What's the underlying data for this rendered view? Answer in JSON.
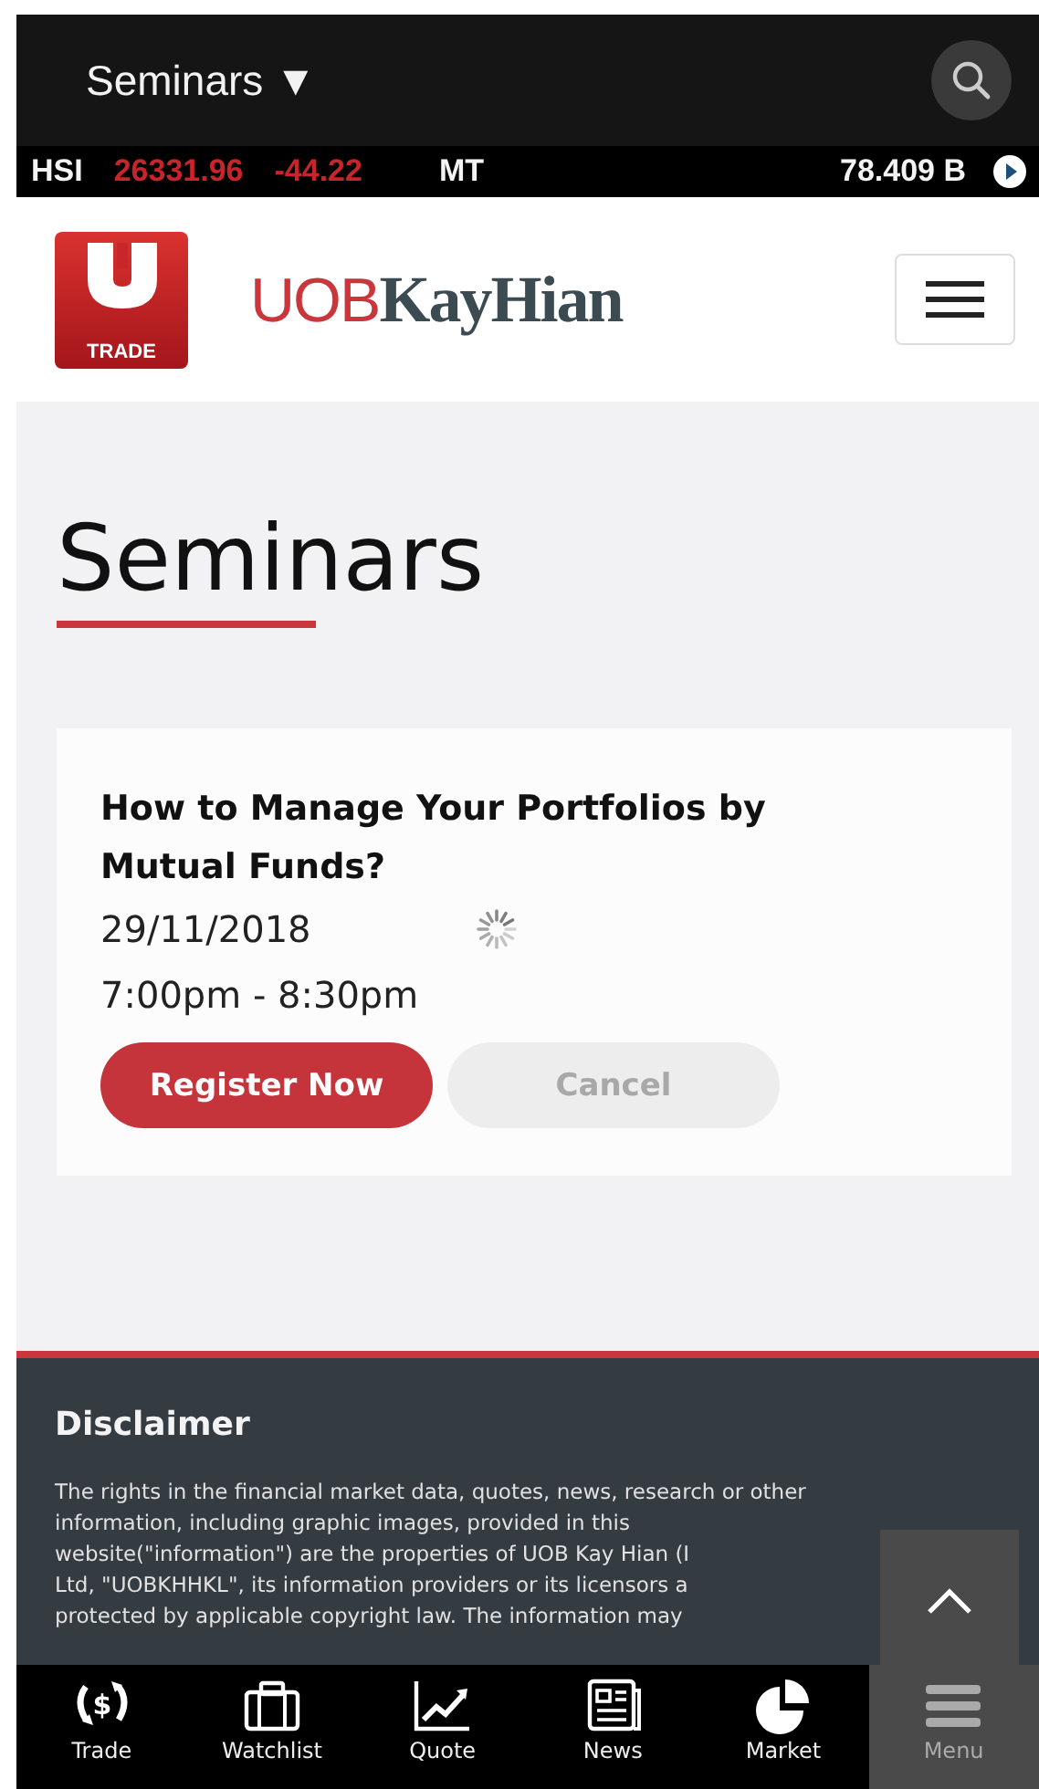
{
  "header": {
    "title": "Seminars",
    "dropdown_glyph": "▼"
  },
  "ticker": {
    "index": "HSI",
    "value": "26331.96",
    "change": "-44.22",
    "turnover_label": "MT",
    "turnover": "78.409 B"
  },
  "logo": {
    "badge_text": "TRADE",
    "wordmark": "UOB**KayHian**"
  },
  "page": {
    "heading": "Seminars"
  },
  "seminars": [
    {
      "title": "How to Manage Your Portfolios by Mutual Funds?",
      "date": "29/11/2018",
      "time": "7:00pm - 8:30pm",
      "loading": true,
      "register_label": "Register Now",
      "cancel_label": "Cancel",
      "cancel_disabled": true
    }
  ],
  "disclaimer": {
    "title": "Disclaimer",
    "lines": [
      "The rights in the financial market data, quotes, news, research or other",
      "information, including graphic images, provided in this",
      "website(\"information\") are the properties of UOB Kay Hian (I",
      "Ltd, \"UOBKHHKL\", its information providers or its licensors a",
      "protected by applicable copyright law. The information may"
    ]
  },
  "bottom_nav": [
    {
      "kind": "trade",
      "label": "Trade",
      "icon_text": "$",
      "selected": false
    },
    {
      "kind": "watchlist",
      "label": "Watchlist",
      "selected": false
    },
    {
      "kind": "quote",
      "label": "Quote",
      "selected": false
    },
    {
      "kind": "news",
      "label": "News",
      "selected": false
    },
    {
      "kind": "market",
      "label": "Market",
      "selected": false
    },
    {
      "kind": "menu",
      "label": "Menu",
      "selected": true
    }
  ]
}
